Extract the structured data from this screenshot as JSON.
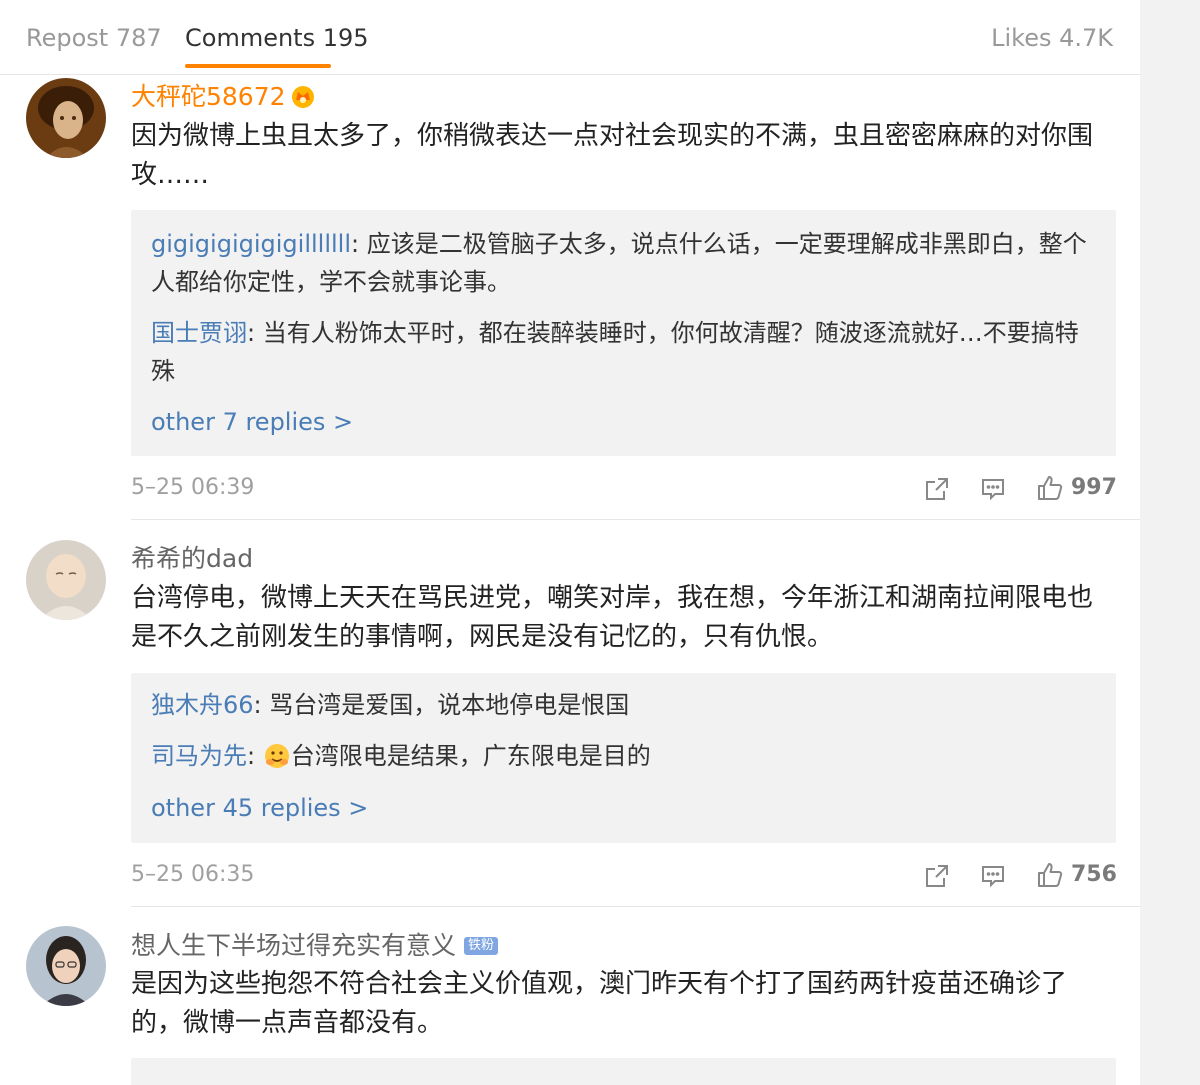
{
  "tabs": {
    "repost": "Repost 787",
    "comments": "Comments 195",
    "likes": "Likes 4.7K"
  },
  "colors": {
    "accent": "#ff8200",
    "link": "#4a7cb6",
    "reply_bg": "#f2f2f2"
  },
  "comments": [
    {
      "user": "大秤砣58672",
      "badge": "crown-vip-icon",
      "text": "因为微博上虫且太多了，你稍微表达一点对社会现实的不满，虫且密密麻麻的对你围攻……",
      "replies": [
        {
          "name": "gigigigigigigilllllll",
          "text": ": 应该是二极管脑子太多，说点什么话，一定要理解成非黑即白，整个人都给你定性，学不会就事论事。"
        },
        {
          "name": "国士贾诩",
          "text": ": 当有人粉饰太平时，都在装醉装睡时，你何故清醒？随波逐流就好…不要搞特殊"
        }
      ],
      "more": "other 7 replies >",
      "time": "5–25 06:39",
      "likes": "997"
    },
    {
      "user": "希希的dad",
      "text": "台湾停电，微博上天天在骂民进党，嘲笑对岸，我在想，今年浙江和湖南拉闸限电也是不久之前刚发生的事情啊，网民是没有记忆的，只有仇恨。",
      "replies": [
        {
          "name": "独木舟66",
          "text": ": 骂台湾是爱国，说本地停电是恨国"
        },
        {
          "name": "司马为先",
          "text": "台湾限电是结果，广东限电是目的"
        }
      ],
      "reply_colon": ": ",
      "more": "other 45 replies >",
      "time": "5–25 06:35",
      "likes": "756"
    },
    {
      "user": "想人生下半场过得充实有意义",
      "badge_text": "铁粉",
      "text": "是因为这些抱怨不符合社会主义价值观，澳门昨天有个打了国药两针疫苗还确诊了的，微博一点声音都没有。"
    }
  ]
}
